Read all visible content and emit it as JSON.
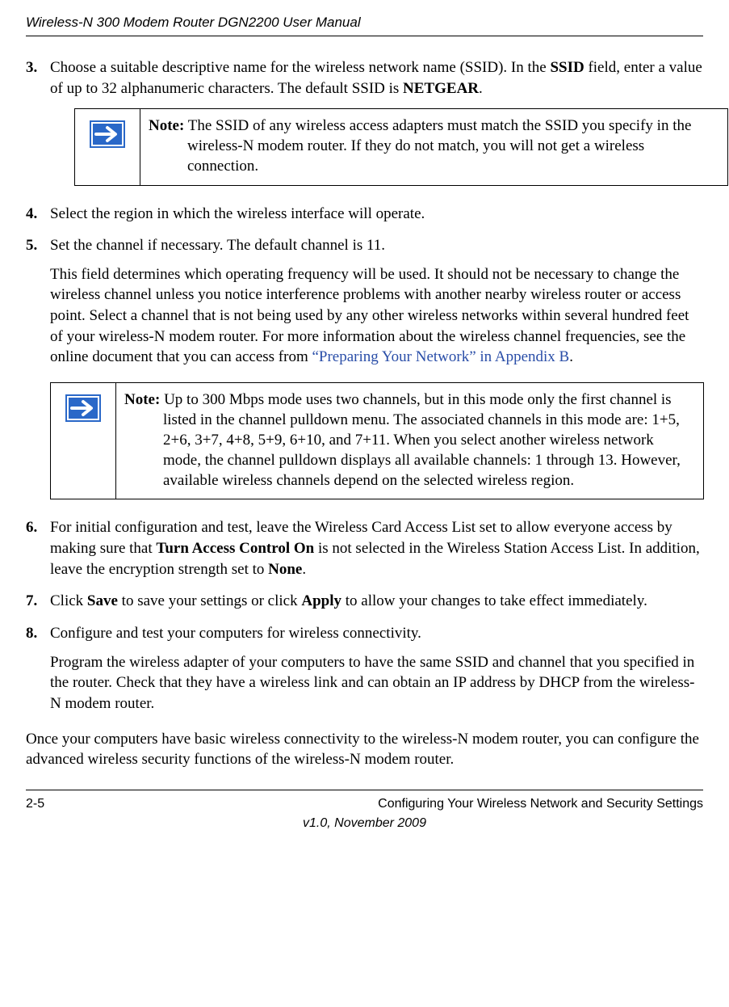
{
  "header": {
    "running_title": "Wireless-N 300 Modem Router DGN2200 User Manual"
  },
  "steps": {
    "s3": {
      "pre": "Choose a suitable descriptive name for the wireless network name (SSID). In the ",
      "b1": "SSID",
      "mid": " field, enter a value of up to 32 alphanumeric characters. The default SSID is ",
      "b2": "NETGEAR",
      "post": "."
    },
    "s4": "Select the region in which the wireless interface will operate.",
    "s5": "Set the channel if necessary. The default channel is 11.",
    "s5_detail_a": "This field determines which operating frequency will be used. It should not be necessary to change the wireless channel unless you notice interference problems with another nearby wireless router or access point. Select a channel that is not being used by any other wireless networks within several hundred feet of your wireless-N modem router. For more information about the wireless channel frequencies, see the online document that you can access from ",
    "s5_detail_link": "“Preparing Your Network” in Appendix B",
    "s5_detail_b": ".",
    "s6": {
      "a": "For initial configuration and test, leave the Wireless Card Access List set to allow everyone access by making sure that ",
      "b1": "Turn Access Control On",
      "b": " is not selected in the Wireless Station Access List. In addition, leave the encryption strength set to ",
      "b2": "None",
      "c": "."
    },
    "s7": {
      "a": "Click ",
      "b1": "Save",
      "b": " to save your settings or click ",
      "b2": "Apply",
      "c": " to allow your changes to take effect immediately."
    },
    "s8": "Configure and test your computers for wireless connectivity.",
    "s8_detail": "Program the wireless adapter of your computers to have the same SSID and channel that you specified in the router. Check that they have a wireless link and can obtain an IP address by DHCP from the wireless-N modem router."
  },
  "notes": {
    "label": "Note:",
    "n1": " The SSID of any wireless access adapters must match the SSID you specify in the wireless-N modem router. If they do not match, you will not get a wireless connection.",
    "n2": " Up to 300 Mbps mode uses two channels, but in this mode only the first channel is listed in the channel pulldown menu. The associated channels in this mode are: 1+5, 2+6, 3+7, 4+8, 5+9, 6+10, and 7+11. When you select another wireless network mode, the channel pulldown displays all available channels: 1 through 13. However, available wireless channels depend on the selected wireless region."
  },
  "closing": "Once your computers have basic wireless connectivity to the wireless-N modem router, you can configure the advanced wireless security functions of the wireless-N modem router.",
  "footer": {
    "page": "2-5",
    "section": "Configuring Your Wireless Network and Security Settings",
    "version": "v1.0, November 2009"
  }
}
